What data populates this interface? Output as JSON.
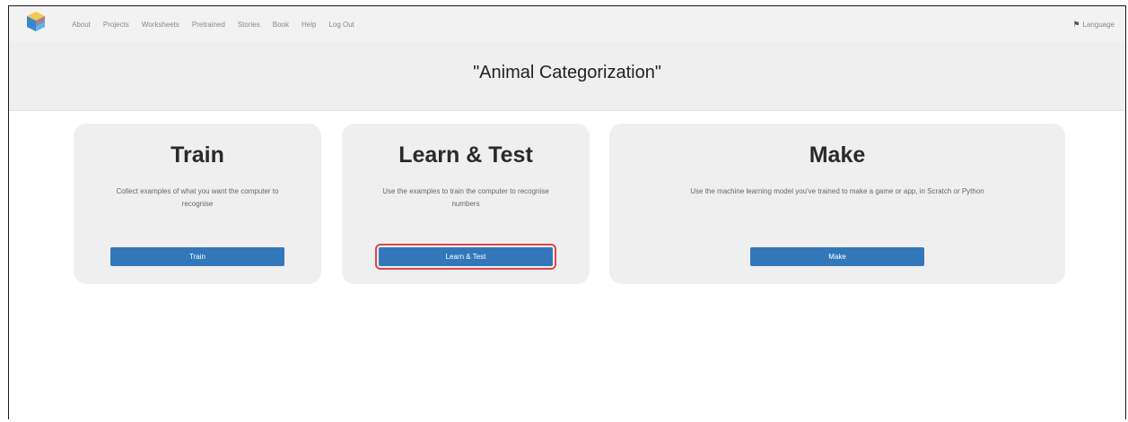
{
  "nav": {
    "items": [
      {
        "label": "About"
      },
      {
        "label": "Projects"
      },
      {
        "label": "Worksheets"
      },
      {
        "label": "Pretrained"
      },
      {
        "label": "Stories"
      },
      {
        "label": "Book"
      },
      {
        "label": "Help"
      },
      {
        "label": "Log Out"
      }
    ],
    "language_label": "Language",
    "language_icon": "globe-icon",
    "logo_icon": "cube-logo-icon"
  },
  "project": {
    "title": "\"Animal Categorization\""
  },
  "cards": {
    "train": {
      "heading": "Train",
      "description": "Collect examples of what you want the computer to recognise",
      "button_label": "Train"
    },
    "learn": {
      "heading": "Learn & Test",
      "description": "Use the examples to train the computer to recognise numbers",
      "button_label": "Learn & Test"
    },
    "make": {
      "heading": "Make",
      "description": "Use the machine learning model you've trained to make a game or app, in Scratch or Python",
      "button_label": "Make"
    }
  },
  "colors": {
    "button": "#3377bb",
    "highlight": "#e0444c",
    "card": "#efefef"
  }
}
